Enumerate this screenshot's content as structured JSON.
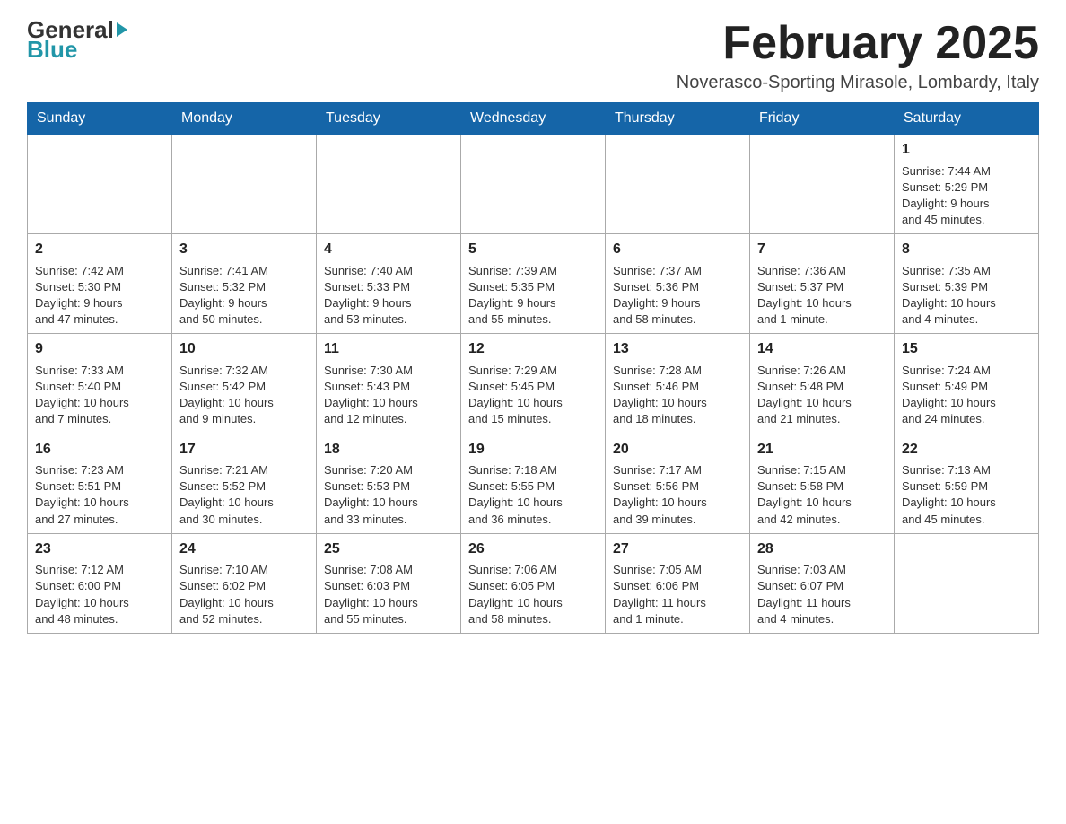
{
  "header": {
    "logo_line1": "General",
    "logo_line2": "Blue",
    "month_title": "February 2025",
    "location": "Noverasco-Sporting Mirasole, Lombardy, Italy"
  },
  "weekdays": [
    "Sunday",
    "Monday",
    "Tuesday",
    "Wednesday",
    "Thursday",
    "Friday",
    "Saturday"
  ],
  "weeks": [
    [
      {
        "day": "",
        "info": ""
      },
      {
        "day": "",
        "info": ""
      },
      {
        "day": "",
        "info": ""
      },
      {
        "day": "",
        "info": ""
      },
      {
        "day": "",
        "info": ""
      },
      {
        "day": "",
        "info": ""
      },
      {
        "day": "1",
        "info": "Sunrise: 7:44 AM\nSunset: 5:29 PM\nDaylight: 9 hours\nand 45 minutes."
      }
    ],
    [
      {
        "day": "2",
        "info": "Sunrise: 7:42 AM\nSunset: 5:30 PM\nDaylight: 9 hours\nand 47 minutes."
      },
      {
        "day": "3",
        "info": "Sunrise: 7:41 AM\nSunset: 5:32 PM\nDaylight: 9 hours\nand 50 minutes."
      },
      {
        "day": "4",
        "info": "Sunrise: 7:40 AM\nSunset: 5:33 PM\nDaylight: 9 hours\nand 53 minutes."
      },
      {
        "day": "5",
        "info": "Sunrise: 7:39 AM\nSunset: 5:35 PM\nDaylight: 9 hours\nand 55 minutes."
      },
      {
        "day": "6",
        "info": "Sunrise: 7:37 AM\nSunset: 5:36 PM\nDaylight: 9 hours\nand 58 minutes."
      },
      {
        "day": "7",
        "info": "Sunrise: 7:36 AM\nSunset: 5:37 PM\nDaylight: 10 hours\nand 1 minute."
      },
      {
        "day": "8",
        "info": "Sunrise: 7:35 AM\nSunset: 5:39 PM\nDaylight: 10 hours\nand 4 minutes."
      }
    ],
    [
      {
        "day": "9",
        "info": "Sunrise: 7:33 AM\nSunset: 5:40 PM\nDaylight: 10 hours\nand 7 minutes."
      },
      {
        "day": "10",
        "info": "Sunrise: 7:32 AM\nSunset: 5:42 PM\nDaylight: 10 hours\nand 9 minutes."
      },
      {
        "day": "11",
        "info": "Sunrise: 7:30 AM\nSunset: 5:43 PM\nDaylight: 10 hours\nand 12 minutes."
      },
      {
        "day": "12",
        "info": "Sunrise: 7:29 AM\nSunset: 5:45 PM\nDaylight: 10 hours\nand 15 minutes."
      },
      {
        "day": "13",
        "info": "Sunrise: 7:28 AM\nSunset: 5:46 PM\nDaylight: 10 hours\nand 18 minutes."
      },
      {
        "day": "14",
        "info": "Sunrise: 7:26 AM\nSunset: 5:48 PM\nDaylight: 10 hours\nand 21 minutes."
      },
      {
        "day": "15",
        "info": "Sunrise: 7:24 AM\nSunset: 5:49 PM\nDaylight: 10 hours\nand 24 minutes."
      }
    ],
    [
      {
        "day": "16",
        "info": "Sunrise: 7:23 AM\nSunset: 5:51 PM\nDaylight: 10 hours\nand 27 minutes."
      },
      {
        "day": "17",
        "info": "Sunrise: 7:21 AM\nSunset: 5:52 PM\nDaylight: 10 hours\nand 30 minutes."
      },
      {
        "day": "18",
        "info": "Sunrise: 7:20 AM\nSunset: 5:53 PM\nDaylight: 10 hours\nand 33 minutes."
      },
      {
        "day": "19",
        "info": "Sunrise: 7:18 AM\nSunset: 5:55 PM\nDaylight: 10 hours\nand 36 minutes."
      },
      {
        "day": "20",
        "info": "Sunrise: 7:17 AM\nSunset: 5:56 PM\nDaylight: 10 hours\nand 39 minutes."
      },
      {
        "day": "21",
        "info": "Sunrise: 7:15 AM\nSunset: 5:58 PM\nDaylight: 10 hours\nand 42 minutes."
      },
      {
        "day": "22",
        "info": "Sunrise: 7:13 AM\nSunset: 5:59 PM\nDaylight: 10 hours\nand 45 minutes."
      }
    ],
    [
      {
        "day": "23",
        "info": "Sunrise: 7:12 AM\nSunset: 6:00 PM\nDaylight: 10 hours\nand 48 minutes."
      },
      {
        "day": "24",
        "info": "Sunrise: 7:10 AM\nSunset: 6:02 PM\nDaylight: 10 hours\nand 52 minutes."
      },
      {
        "day": "25",
        "info": "Sunrise: 7:08 AM\nSunset: 6:03 PM\nDaylight: 10 hours\nand 55 minutes."
      },
      {
        "day": "26",
        "info": "Sunrise: 7:06 AM\nSunset: 6:05 PM\nDaylight: 10 hours\nand 58 minutes."
      },
      {
        "day": "27",
        "info": "Sunrise: 7:05 AM\nSunset: 6:06 PM\nDaylight: 11 hours\nand 1 minute."
      },
      {
        "day": "28",
        "info": "Sunrise: 7:03 AM\nSunset: 6:07 PM\nDaylight: 11 hours\nand 4 minutes."
      },
      {
        "day": "",
        "info": ""
      }
    ]
  ]
}
